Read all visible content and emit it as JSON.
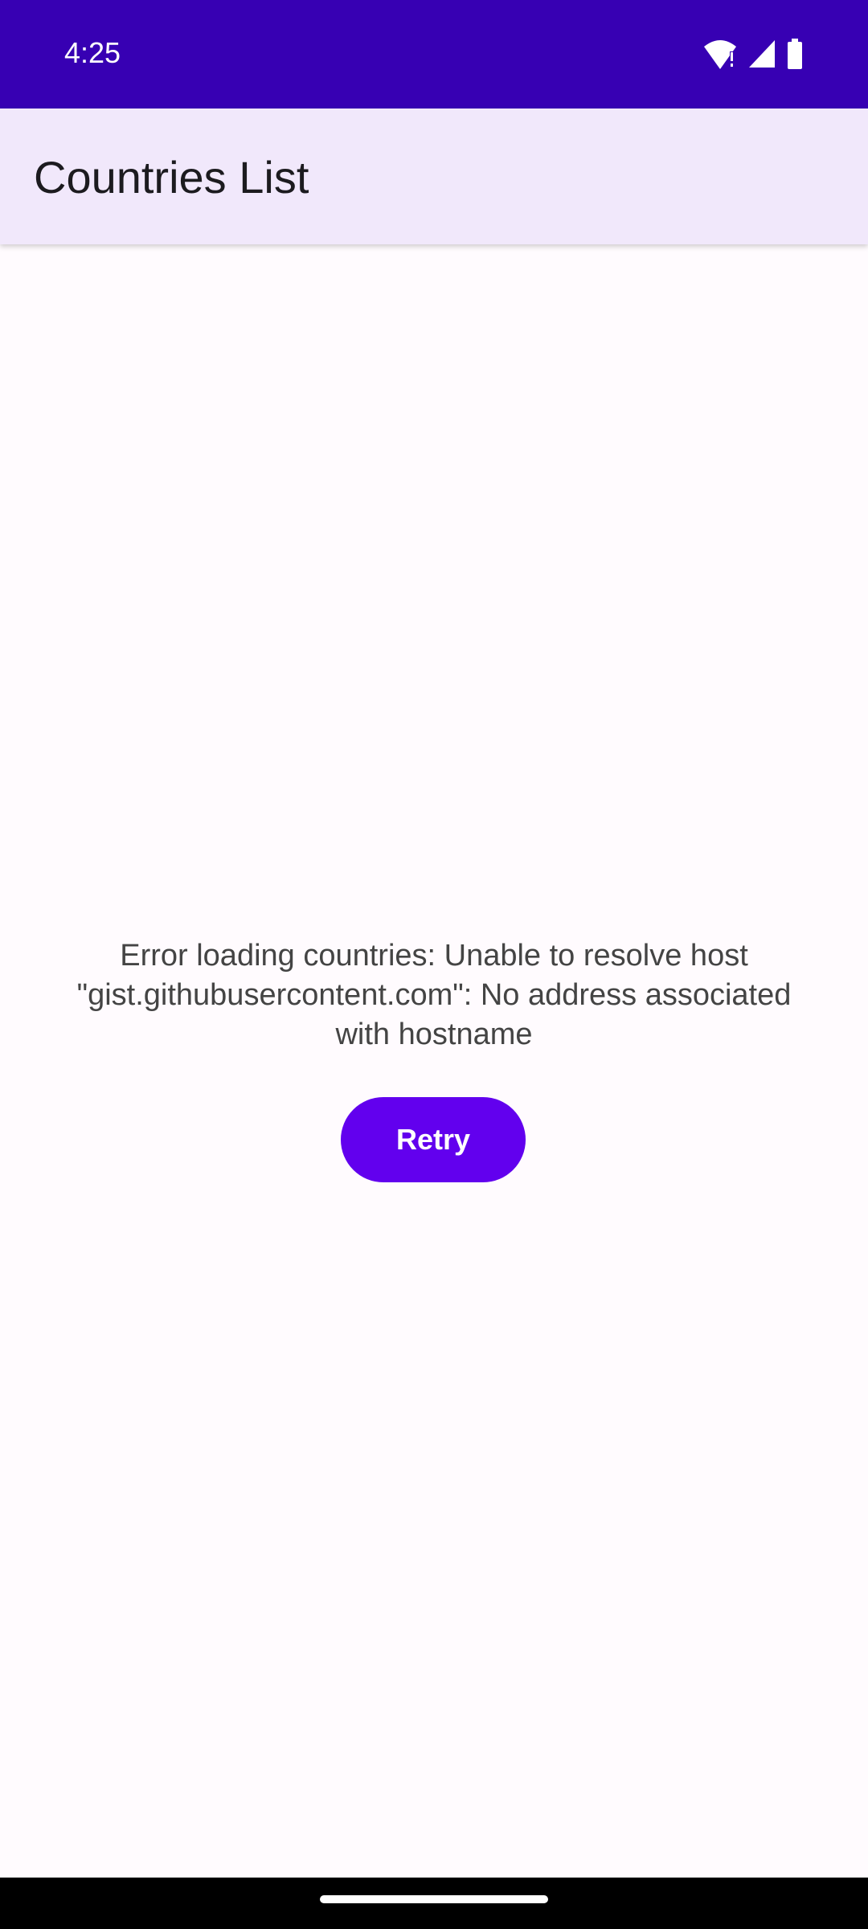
{
  "status_bar": {
    "time": "4:25",
    "icons": [
      "wifi-alert-icon",
      "cellular-signal-icon",
      "battery-icon"
    ],
    "background": "#3700b3"
  },
  "app_bar": {
    "title": "Countries List",
    "background": "#f1e8fb"
  },
  "main": {
    "error_message": "Error loading countries: Unable to resolve host \"gist.githubusercontent.com\": No address associated with hostname",
    "retry_label": "Retry"
  },
  "colors": {
    "accent": "#6200ee",
    "status_bar": "#3700b3",
    "background": "#fffbfe"
  }
}
